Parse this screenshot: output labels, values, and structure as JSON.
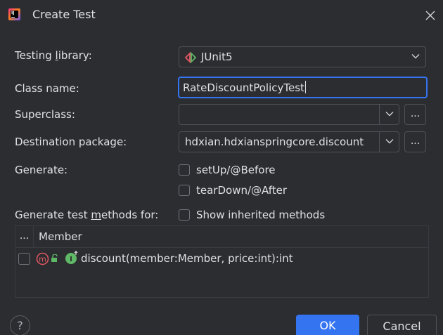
{
  "window": {
    "title": "Create Test",
    "app_icon": "intellij-icon",
    "close_icon": "close-icon"
  },
  "form": {
    "testing_library": {
      "label_pre": "Testing ",
      "label_mnemonic": "l",
      "label_post": "ibrary:",
      "value": "JUnit5",
      "icon": "junit-icon"
    },
    "class_name": {
      "label": "Class name:",
      "value": "RateDiscountPolicyTest"
    },
    "superclass": {
      "label": "Superclass:",
      "value": "",
      "browse_label": "..."
    },
    "destination_package": {
      "label": "Destination package:",
      "value": "hdxian.hdxianspringcore.discount",
      "browse_label": "..."
    },
    "generate": {
      "label": "Generate:",
      "options": [
        {
          "label": "setUp/@Before",
          "checked": false
        },
        {
          "label": "tearDown/@After",
          "checked": false
        }
      ]
    },
    "methods": {
      "label_pre": "Generate test ",
      "label_mnemonic": "m",
      "label_post": "ethods for:",
      "show_inherited_label": "Show inherited methods",
      "show_inherited_checked": false
    }
  },
  "table": {
    "columns": [
      "...",
      "Member"
    ],
    "rows": [
      {
        "checked": false,
        "text": "discount(member:Member, price:int):int"
      }
    ]
  },
  "footer": {
    "help_label": "?",
    "ok_label": "OK",
    "cancel_label": "Cancel"
  },
  "colors": {
    "background": "#2b2d30",
    "accent": "#3574f0",
    "border": "#4e5157",
    "text": "#dfe1e5",
    "method_icon": "#e55765",
    "implementing_icon": "#5fb865"
  }
}
